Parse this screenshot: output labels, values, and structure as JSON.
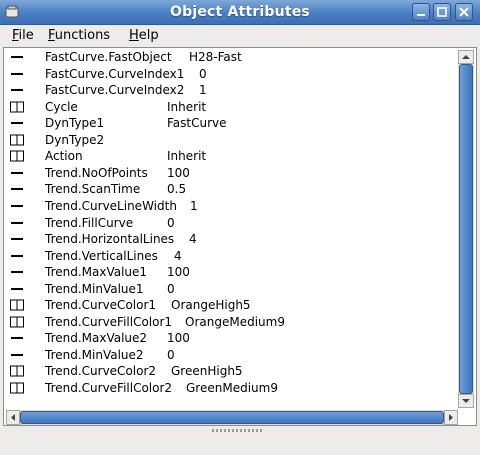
{
  "window": {
    "title": "Object Attributes"
  },
  "menu": [
    {
      "label": "File",
      "mnemonic": "F",
      "rest": "ile"
    },
    {
      "label": "Functions",
      "mnemonic": "F",
      "rest": "unctions"
    },
    {
      "label": "Help",
      "mnemonic": "H",
      "rest": "elp"
    }
  ],
  "rows": [
    {
      "icon": "attribute-icon",
      "name": "FastCurve.FastObject",
      "value": "H28-Fast"
    },
    {
      "icon": "attribute-icon",
      "name": "FastCurve.CurveIndex1",
      "value": "0"
    },
    {
      "icon": "attribute-icon",
      "name": "FastCurve.CurveIndex2",
      "value": "1"
    },
    {
      "icon": "book-icon",
      "name": "Cycle",
      "value": "Inherit"
    },
    {
      "icon": "attribute-icon",
      "name": "DynType1",
      "value": "FastCurve"
    },
    {
      "icon": "book-icon",
      "name": "DynType2",
      "value": ""
    },
    {
      "icon": "book-icon",
      "name": "Action",
      "value": "Inherit"
    },
    {
      "icon": "attribute-icon",
      "name": "Trend.NoOfPoints",
      "value": "100"
    },
    {
      "icon": "attribute-icon",
      "name": "Trend.ScanTime",
      "value": "0.5"
    },
    {
      "icon": "attribute-icon",
      "name": "Trend.CurveLineWidth",
      "value": "1"
    },
    {
      "icon": "attribute-icon",
      "name": "Trend.FillCurve",
      "value": "0"
    },
    {
      "icon": "attribute-icon",
      "name": "Trend.HorizontalLines",
      "value": "4"
    },
    {
      "icon": "attribute-icon",
      "name": "Trend.VerticalLines",
      "value": "4"
    },
    {
      "icon": "attribute-icon",
      "name": "Trend.MaxValue1",
      "value": "100"
    },
    {
      "icon": "attribute-icon",
      "name": "Trend.MinValue1",
      "value": "0"
    },
    {
      "icon": "book-icon",
      "name": "Trend.CurveColor1",
      "value": "OrangeHigh5"
    },
    {
      "icon": "book-icon",
      "name": "Trend.CurveFillColor1",
      "value": "OrangeMedium9"
    },
    {
      "icon": "attribute-icon",
      "name": "Trend.MaxValue2",
      "value": "100"
    },
    {
      "icon": "attribute-icon",
      "name": "Trend.MinValue2",
      "value": "0"
    },
    {
      "icon": "book-icon",
      "name": "Trend.CurveColor2",
      "value": "GreenHigh5"
    },
    {
      "icon": "book-icon",
      "name": "Trend.CurveFillColor2",
      "value": "GreenMedium9"
    }
  ],
  "icons": {
    "app": "window-app-icon",
    "minimize": "minimize-icon",
    "maximize": "maximize-icon",
    "close": "close-icon"
  },
  "colors": {
    "titlebar": "#4a7ec2",
    "scroll_thumb": "#4f82c6"
  }
}
